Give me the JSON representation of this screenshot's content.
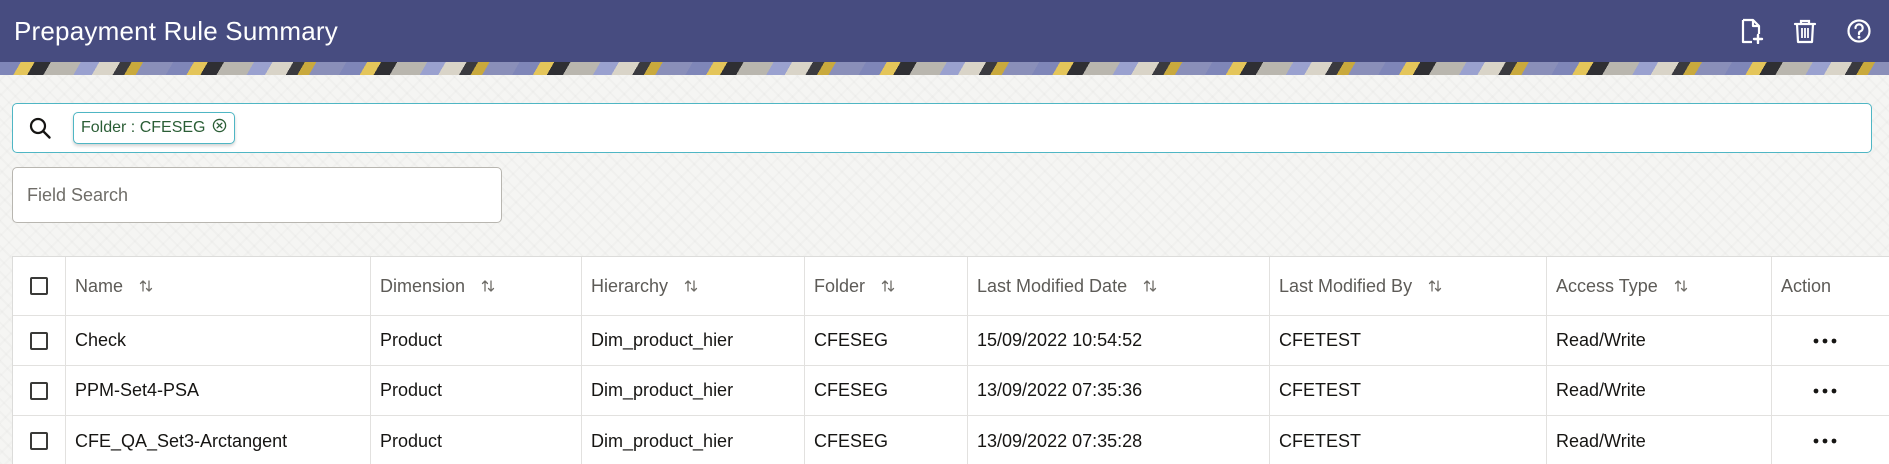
{
  "header": {
    "title": "Prepayment Rule Summary",
    "icons": [
      "add-document-icon",
      "delete-icon",
      "help-icon"
    ]
  },
  "search": {
    "chip_label": "Folder : CFESEG",
    "field_placeholder": "Field Search"
  },
  "table": {
    "columns": [
      "Name",
      "Dimension",
      "Hierarchy",
      "Folder",
      "Last Modified Date",
      "Last Modified By",
      "Access Type",
      "Action"
    ],
    "rows": [
      {
        "name": "Check",
        "dimension": "Product",
        "hierarchy": "Dim_product_hier",
        "folder": "CFESEG",
        "modified_date": "15/09/2022 10:54:52",
        "modified_by": "CFETEST",
        "access_type": "Read/Write"
      },
      {
        "name": "PPM-Set4-PSA",
        "dimension": "Product",
        "hierarchy": "Dim_product_hier",
        "folder": "CFESEG",
        "modified_date": "13/09/2022 07:35:36",
        "modified_by": "CFETEST",
        "access_type": "Read/Write"
      },
      {
        "name": "CFE_QA_Set3-Arctangent",
        "dimension": "Product",
        "hierarchy": "Dim_product_hier",
        "folder": "CFESEG",
        "modified_date": "13/09/2022 07:35:28",
        "modified_by": "CFETEST",
        "access_type": "Read/Write"
      }
    ]
  },
  "colors": {
    "header_bg": "#474c80",
    "accent_border": "#4fb6c4",
    "chip_text": "#2b5e36"
  }
}
